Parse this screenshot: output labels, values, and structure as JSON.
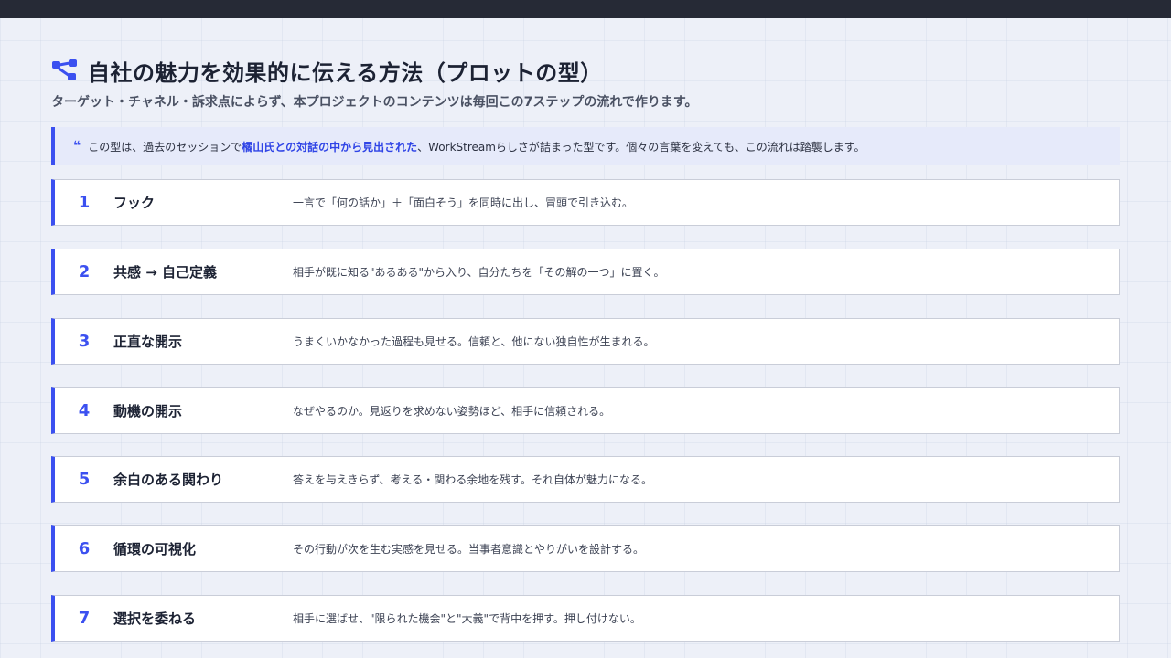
{
  "header": {
    "title": "自社の魅力を効果的に伝える方法（プロットの型）",
    "title_icon": "flow-nodes-icon",
    "subtitle": "ターゲット・チャネル・訴求点によらず、本プロジェクトのコンテンツは毎回この7ステップの流れで作ります。"
  },
  "quote": {
    "icon": "quote-icon",
    "mark": "❝",
    "text_before": "この型は、過去のセッションで",
    "highlight": "橘山氏との対話の中から見出された",
    "text_after": "、WorkStreamらしさが詰まった型です。個々の言葉を変えても、この流れは踏襲します。"
  },
  "colors": {
    "accent": "#3b50f0",
    "background": "#edf0f8",
    "topbar": "#262a36",
    "card": "#ffffff"
  },
  "steps": [
    {
      "num": "1",
      "title": "フック",
      "desc": "一言で「何の話か」＋「面白そう」を同時に出し、冒頭で引き込む。"
    },
    {
      "num": "2",
      "title": "共感 → 自己定義",
      "desc": "相手が既に知る\"あるある\"から入り、自分たちを「その解の一つ」に置く。"
    },
    {
      "num": "3",
      "title": "正直な開示",
      "desc": "うまくいかなかった過程も見せる。信頼と、他にない独自性が生まれる。"
    },
    {
      "num": "4",
      "title": "動機の開示",
      "desc": "なぜやるのか。見返りを求めない姿勢ほど、相手に信頼される。"
    },
    {
      "num": "5",
      "title": "余白のある関わり",
      "desc": "答えを与えきらず、考える・関わる余地を残す。それ自体が魅力になる。"
    },
    {
      "num": "6",
      "title": "循環の可視化",
      "desc": "その行動が次を生む実感を見せる。当事者意識とやりがいを設計する。"
    },
    {
      "num": "7",
      "title": "選択を委ねる",
      "desc": "相手に選ばせ、\"限られた機会\"と\"大義\"で背中を押す。押し付けない。"
    }
  ]
}
